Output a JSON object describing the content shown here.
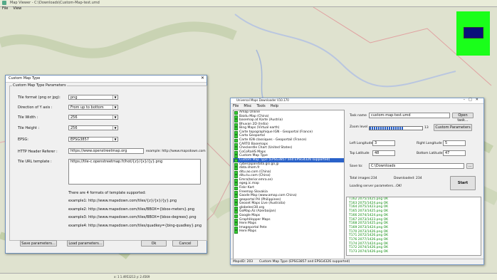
{
  "app": {
    "title": "Map Viewer - C:\\Downloads\\Custom-Map-test.umd",
    "menu": [
      "File",
      "View"
    ]
  },
  "colors": {
    "map_bg": "#d8dcc8",
    "green_preview": "#1aff1a",
    "navy_preview": "#0a0f7a",
    "selection": "#2a62c9",
    "log_text": "#0a8a0a"
  },
  "dialog": {
    "title": "Custom Map Type",
    "group_title": "Custom Map Type Parameters",
    "tile_format_label": "Tile format (png or jpg):",
    "tile_format_value": "png",
    "direction_label": "Direction of Y axis :",
    "direction_value": "From up to bottom",
    "tile_width_label": "Tile Width :",
    "tile_width_value": "256",
    "tile_height_label": "Tile Height :",
    "tile_height_value": "256",
    "epsg_label": "EPSG:",
    "epsg_value": "EPSG3857",
    "referer_label": "HTTP Header Referer :",
    "referer_value": "https://www.openstreetmap.org",
    "referer_example": "example: http://www.mapsdown.com",
    "url_label": "Tile URL template :",
    "url_value": "https://tile-c.openstreetmap.fr/hot/{z}/{x}/{y}.png",
    "formats_note": "There are 4 formats of template supported:",
    "examples": [
      "example1: http://www.mapsdown.com/tiles/{z}/{x}/{y}.png",
      "example2: http://www.mapsdown.com/tiles/BBOX={bbox-meters}.png",
      "example3: http://www.mapsdown.com/tiles/BBOX={bbox-degrees}.png",
      "example4: http://www.mapsdown.com/tiles/quadkey={bing-quadkey}.png"
    ],
    "save_btn": "Save parameters...",
    "load_btn": "Load parameters...",
    "ok_btn": "Ok",
    "cancel_btn": "Cancel"
  },
  "downloader": {
    "title": "Universal Maps Downloader V10.170",
    "menu": [
      "File",
      "Misc",
      "Tools",
      "Help"
    ],
    "map_list": [
      "Amap Online",
      "Baidu Map (China)",
      "basemap.at Karte (Austria)",
      "Bhuvan 2D (India)",
      "Bing Maps (Virtual earth)",
      "Carte topographique IGN - Geoportal (France)",
      "Carto Geoportal",
      "Carte IGN classiques - Geoportail (France)",
      "CARTO Basemaps",
      "Checkerdle Chart (United States)",
      "CoCoRaHS Maps",
      "Custom Map Type",
      "Custom Map Type (EPSG3857 and EPSG4326 supported)",
      "cyberjapandata.gsi.go.jp",
      "data.shom.fr",
      "ditu.ao.com (China)",
      "ditu.tu.com (China)",
      "Emra(terior.emra.se)",
      "egeg.ic.map",
      "Fiskr Kart",
      "Freemap Slovakia",
      "Gaode Map (www.amap.com China)",
      "geoportal PH (Philippines)",
      "Geoset Maps Live (Australia)",
      "globeles(30.org",
      "GoMap.Az (Azerbaijan)",
      "Google Maps",
      "GraphHopper Maps",
      "Here Maps",
      "Imageportal Pete",
      "Here Maps"
    ],
    "selected_index": 12,
    "task_name_label": "Task name",
    "task_name_value": "custom-map-test.umd",
    "open_task_btn": "Open task...",
    "zoom_label": "Zoom level",
    "zoom_value": "13",
    "custom_params_btn": "Custom Parameters",
    "left_lon_label": "Left Longitude",
    "left_lon_value": "3",
    "right_lon_label": "Right Longitude",
    "right_lon_value": "5",
    "top_lat_label": "Top Latitude",
    "top_lat_value": "48",
    "bottom_lat_label": "Bottom Latitude",
    "bottom_lat_value": "47",
    "save_to_label": "Save to:",
    "save_to_value": "C:\\Downloads",
    "browse_btn": "...",
    "total_images_label": "Total images:",
    "total_images_value": "234",
    "downloaded_label": "Downloaded:",
    "downloaded_value": "234",
    "loading_text": "Loading server parameters...OK!",
    "start_btn": "Start",
    "log": [
      "T162 2075/1425.png  OK",
      "T163 2075/1424.png  OK",
      "T164 2075/1423.png  OK",
      "T165 2073/1425.png  OK",
      "T166 2074/1424.png  OK",
      "T167 2073/1423.png  OK",
      "T168 2072/1425.png  OK",
      "T169 2073/1424.png  OK",
      "T170 2073/1426.png  OK",
      "T171 2072/1426.png  OK",
      "T176 2077/1426.png  OK",
      "T174 2077/1424.png  OK",
      "T172 2074/1426.png  OK",
      "T173 2074/1426.png  OK"
    ],
    "status_left": "MapsID: 203",
    "status_right": "Custom Map Type (EPSG3857 and EPSG4326 supported)"
  },
  "viewer_status": "x: 1 1.4953213  y: 2.4569"
}
